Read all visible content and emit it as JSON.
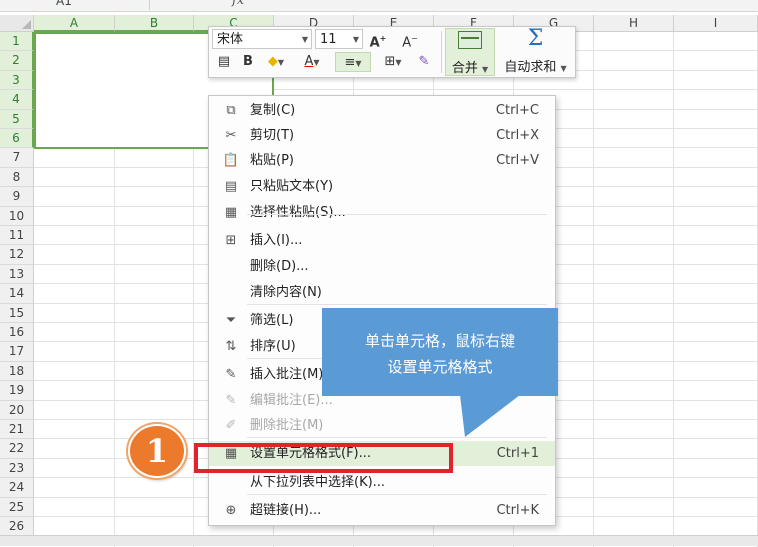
{
  "formula_bar": {
    "name_box": "A1",
    "fx_label": "fx"
  },
  "sheet": {
    "columns": [
      "A",
      "B",
      "C",
      "D",
      "E",
      "F",
      "G",
      "H",
      "I"
    ],
    "rows": [
      "1",
      "2",
      "3",
      "4",
      "5",
      "6",
      "7",
      "8",
      "9",
      "10",
      "11",
      "12",
      "13",
      "14",
      "15",
      "16",
      "17",
      "18",
      "19",
      "20",
      "21",
      "22",
      "23",
      "24",
      "25",
      "26"
    ],
    "selected_range": "A1:C6",
    "accent_color": "#6aa84f"
  },
  "mini_toolbar": {
    "font_name": "宋体",
    "font_size": "11",
    "increase_font": "A",
    "decrease_font": "A",
    "bold": "B",
    "font_color_glyph": "A",
    "merge_label": "合并",
    "autosum_glyph": "Σ",
    "autosum_label": "自动求和"
  },
  "context_menu": {
    "items": [
      {
        "icon": "copy-icon",
        "label": "复制(C)",
        "shortcut": "Ctrl+C",
        "disabled": false
      },
      {
        "icon": "cut-icon",
        "label": "剪切(T)",
        "shortcut": "Ctrl+X",
        "disabled": false
      },
      {
        "icon": "paste-icon",
        "label": "粘贴(P)",
        "shortcut": "Ctrl+V",
        "disabled": false
      },
      {
        "icon": "paste-text-icon",
        "label": "只粘贴文本(Y)",
        "shortcut": "",
        "disabled": false
      },
      {
        "icon": "paste-special-icon",
        "label": "选择性粘贴(S)...",
        "shortcut": "",
        "disabled": false
      },
      {
        "icon": "insert-icon",
        "label": "插入(I)...",
        "shortcut": "",
        "disabled": false
      },
      {
        "icon": "",
        "label": "删除(D)...",
        "shortcut": "",
        "disabled": false
      },
      {
        "icon": "",
        "label": "清除内容(N)",
        "shortcut": "",
        "disabled": false
      },
      {
        "icon": "filter-icon",
        "label": "筛选(L)",
        "shortcut": "",
        "disabled": false
      },
      {
        "icon": "sort-icon",
        "label": "排序(U)",
        "shortcut": "",
        "disabled": false
      },
      {
        "icon": "insert-comment-icon",
        "label": "插入批注(M)",
        "shortcut": "",
        "disabled": false
      },
      {
        "icon": "edit-comment-icon",
        "label": "编辑批注(E)...",
        "shortcut": "",
        "disabled": true
      },
      {
        "icon": "delete-comment-icon",
        "label": "删除批注(M)",
        "shortcut": "",
        "disabled": true
      },
      {
        "icon": "format-cells-icon",
        "label": "设置单元格格式(F)...",
        "shortcut": "Ctrl+1",
        "disabled": false,
        "highlighted": true
      },
      {
        "icon": "",
        "label": "从下拉列表中选择(K)...",
        "shortcut": "",
        "disabled": false
      },
      {
        "icon": "hyperlink-icon",
        "label": "超链接(H)...",
        "shortcut": "Ctrl+K",
        "disabled": false
      }
    ]
  },
  "callout": {
    "line1": "单击单元格，鼠标右键",
    "line2": "设置单元格格式",
    "color": "#5b9bd5"
  },
  "step_badge": {
    "number": "1",
    "color": "#ec7a2c"
  },
  "highlight_color": "#e0242b"
}
